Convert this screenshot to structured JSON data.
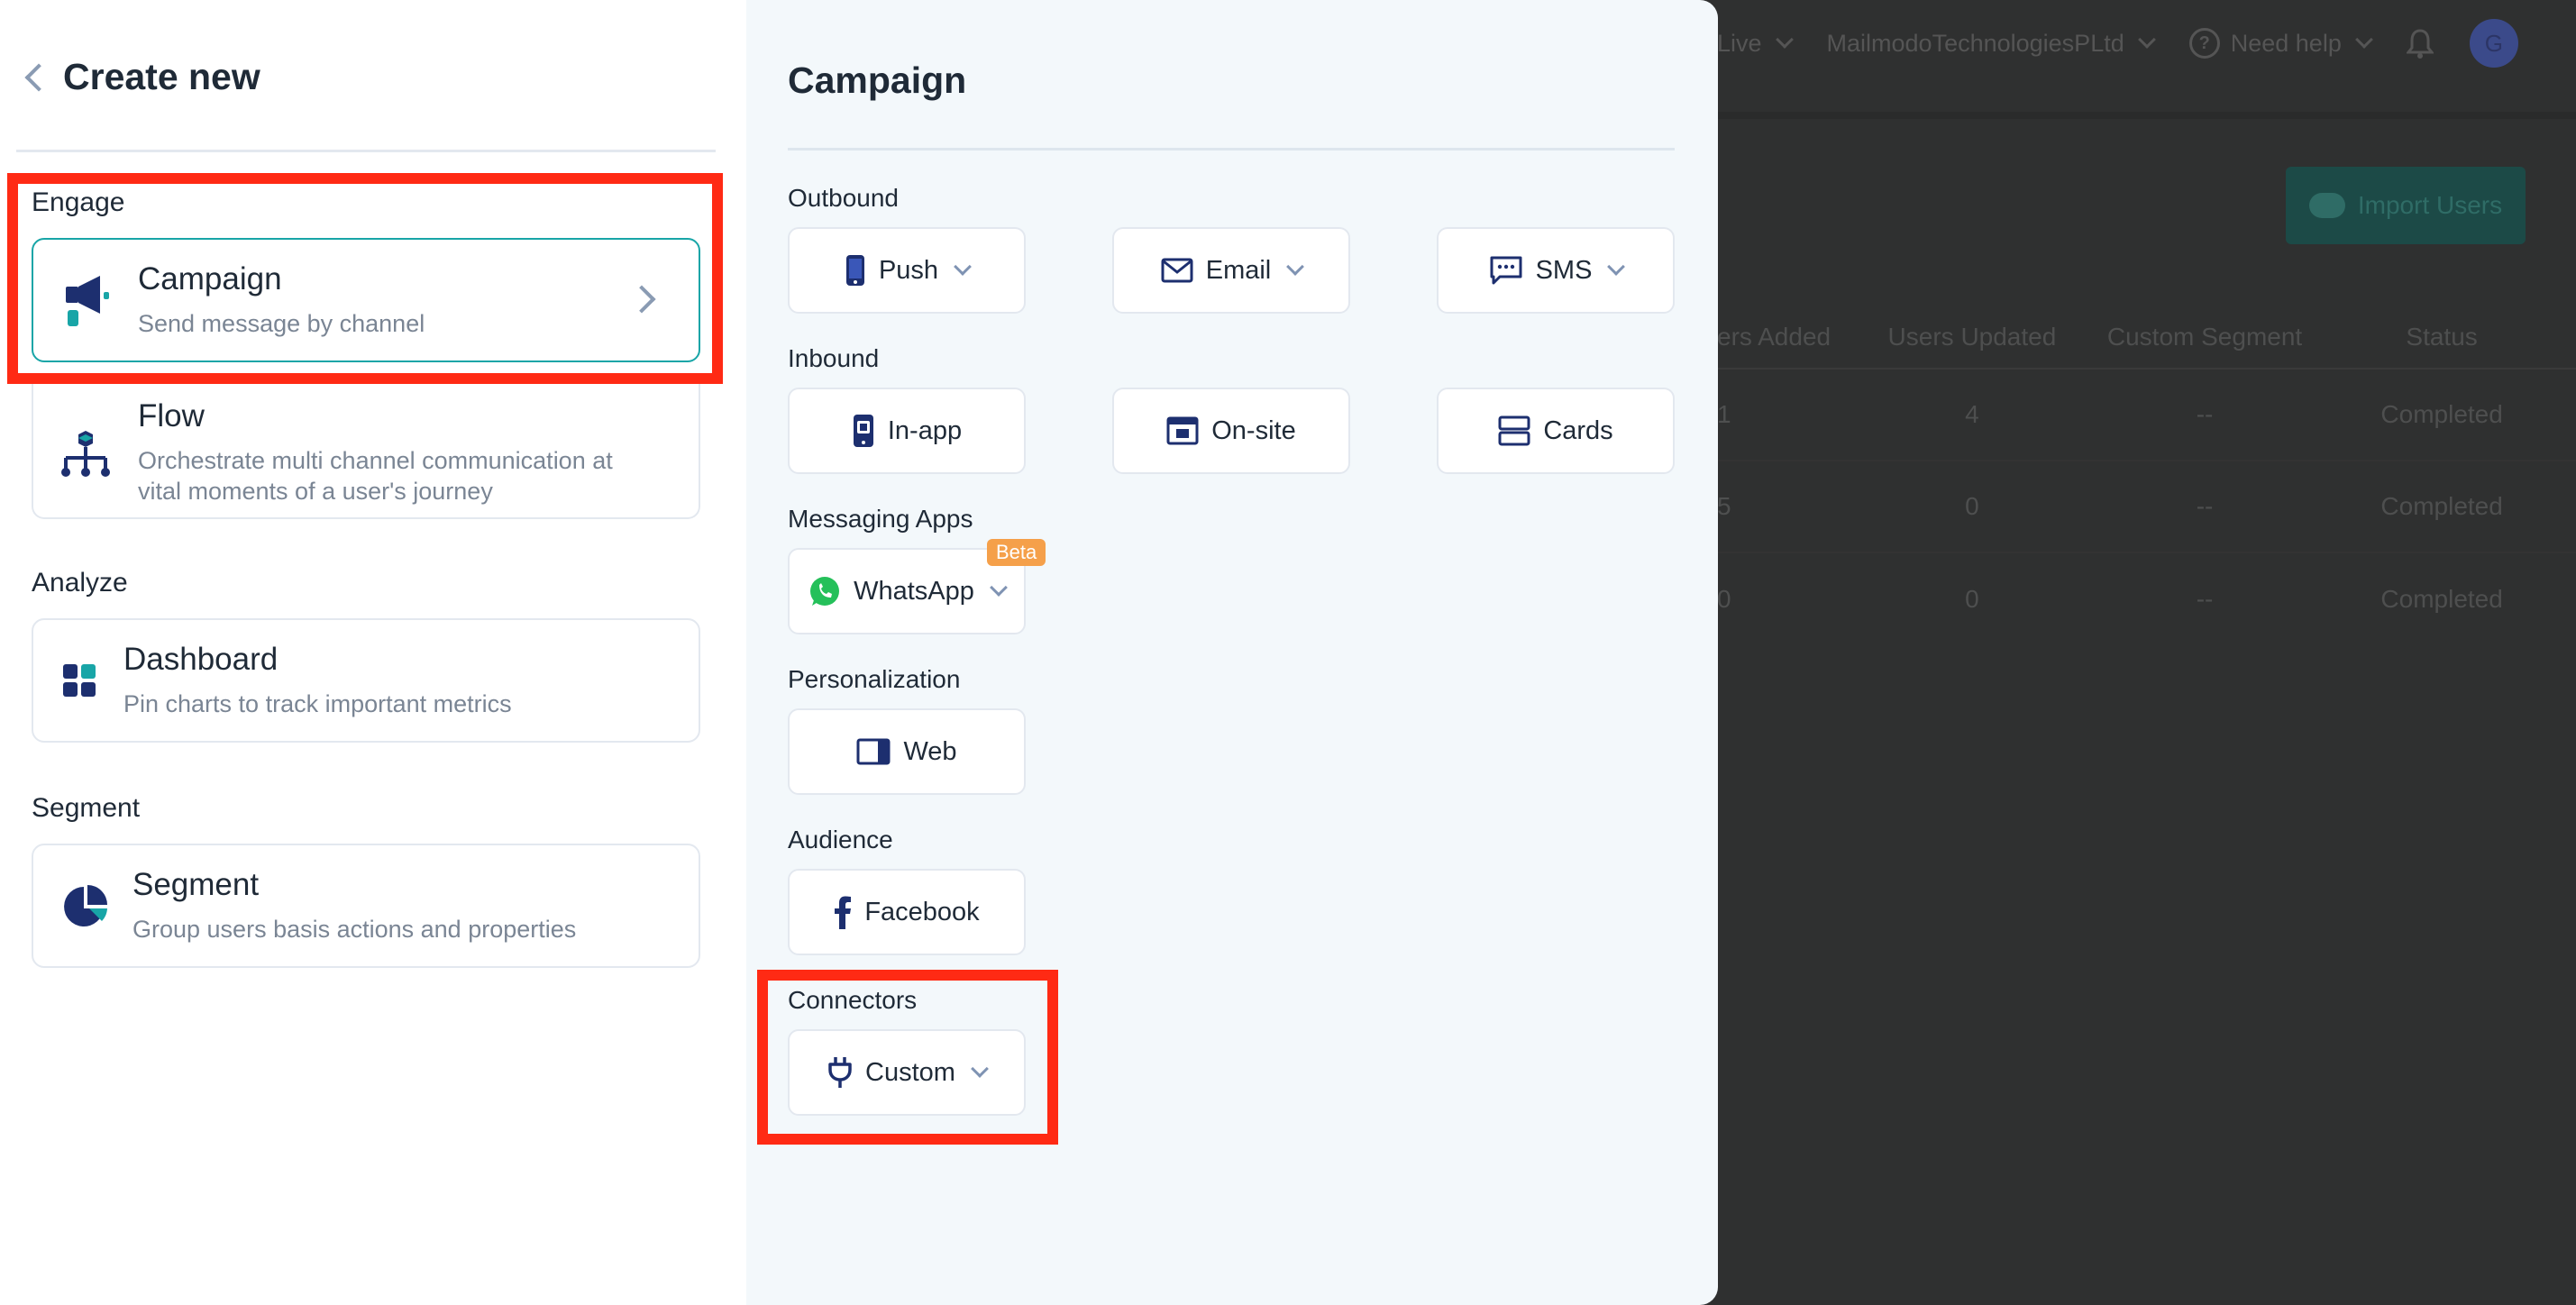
{
  "background": {
    "topbar": {
      "env": "Live",
      "org": "MailmodoTechnologiesPLtd",
      "help": "Need help",
      "avatar": "G"
    },
    "import_button": "Import Users",
    "table": {
      "headers": [
        "ers Added",
        "Users Updated",
        "Custom Segment",
        "Status"
      ],
      "rows": [
        [
          "1",
          "4",
          "--",
          "Completed"
        ],
        [
          "5",
          "0",
          "--",
          "Completed"
        ],
        [
          "0",
          "0",
          "--",
          "Completed"
        ]
      ]
    }
  },
  "left_panel": {
    "title": "Create new",
    "sections": {
      "engage": "Engage",
      "analyze": "Analyze",
      "segment": "Segment"
    },
    "cards": {
      "campaign": {
        "title": "Campaign",
        "desc": "Send message by channel"
      },
      "flow": {
        "title": "Flow",
        "desc_line1": "Orchestrate multi channel communication at",
        "desc_line2": "vital moments of a user's journey"
      },
      "dashboard": {
        "title": "Dashboard",
        "desc": "Pin charts to track important metrics"
      },
      "segment": {
        "title": "Segment",
        "desc": "Group users basis actions and properties"
      }
    }
  },
  "right_panel": {
    "title": "Campaign",
    "groups": {
      "outbound": "Outbound",
      "inbound": "Inbound",
      "messaging": "Messaging Apps",
      "personalization": "Personalization",
      "audience": "Audience",
      "connectors": "Connectors"
    },
    "buttons": {
      "push": "Push",
      "email": "Email",
      "sms": "SMS",
      "inapp": "In-app",
      "onsite": "On-site",
      "cards": "Cards",
      "whatsapp": "WhatsApp",
      "beta": "Beta",
      "web": "Web",
      "facebook": "Facebook",
      "custom": "Custom"
    }
  },
  "colors": {
    "accent_teal": "#18a5a7",
    "icon_navy": "#1d2f6f",
    "highlight_red": "#ff2a14",
    "beta_orange": "#f5a04a",
    "whatsapp_green": "#25c05a"
  }
}
